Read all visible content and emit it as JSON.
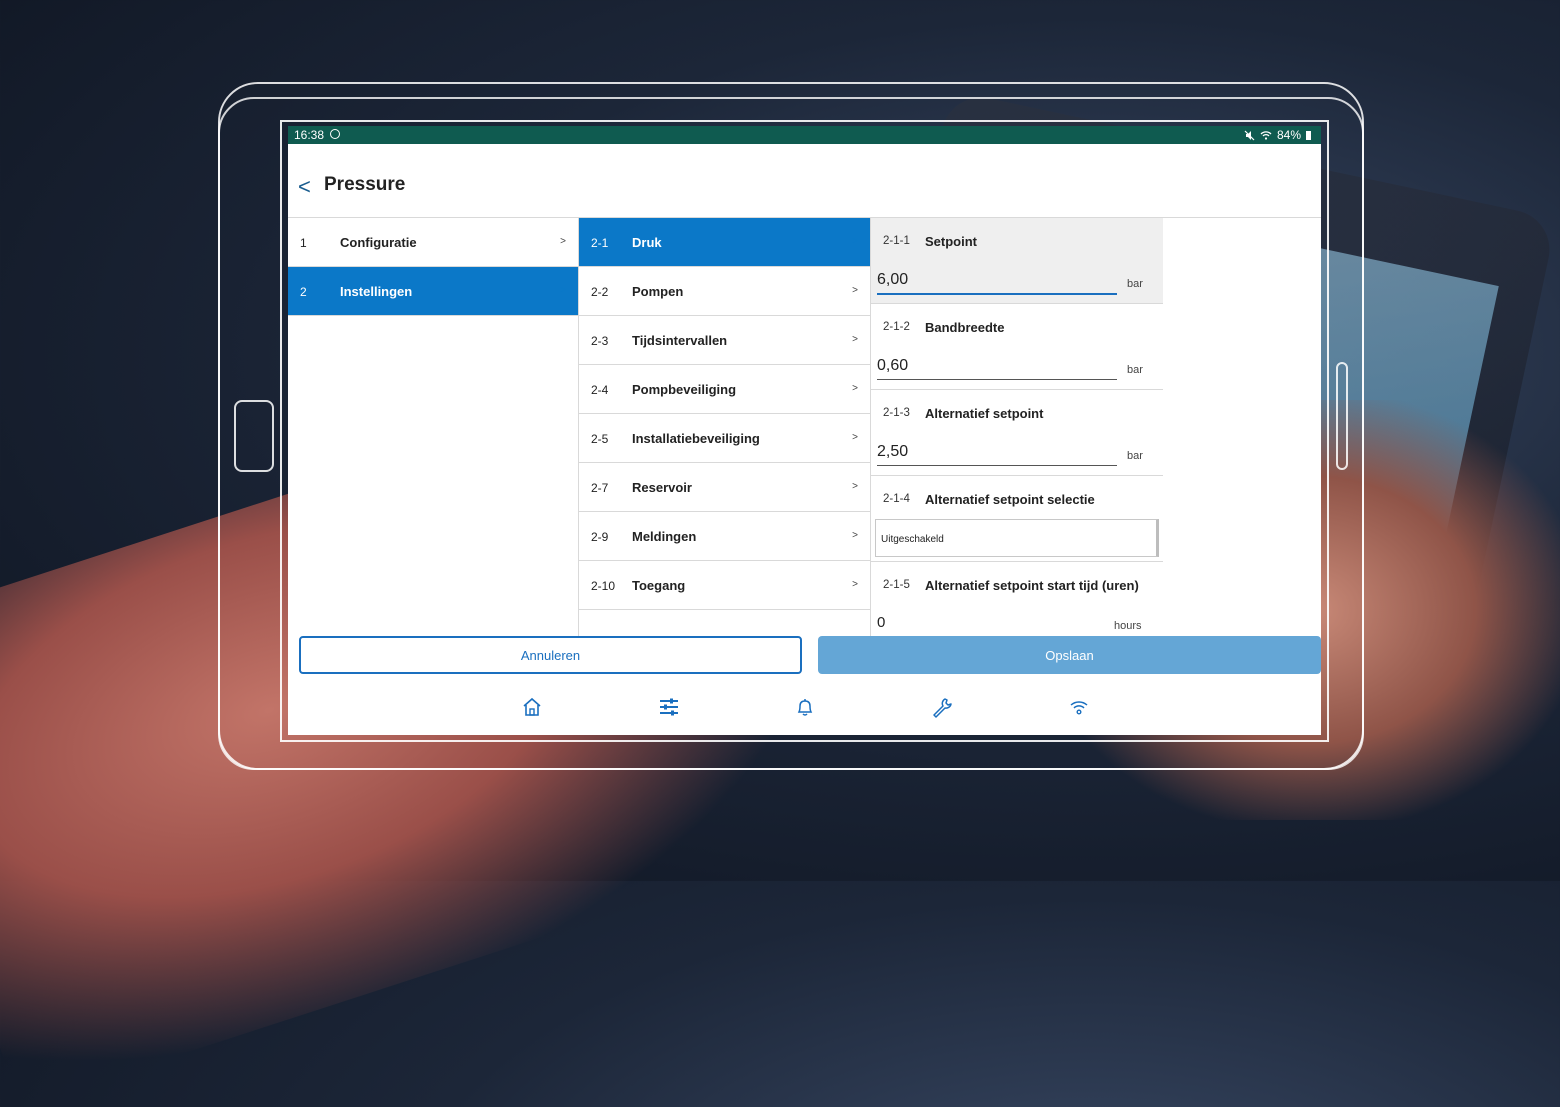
{
  "statusbar": {
    "time": "16:38",
    "battery": "84%"
  },
  "header": {
    "title": "Pressure"
  },
  "col1": [
    {
      "code": "1",
      "label": "Configuratie",
      "active": false
    },
    {
      "code": "2",
      "label": "Instellingen",
      "active": true
    }
  ],
  "col2": [
    {
      "code": "2-1",
      "label": "Druk",
      "active": true
    },
    {
      "code": "2-2",
      "label": "Pompen",
      "active": false
    },
    {
      "code": "2-3",
      "label": "Tijdsintervallen",
      "active": false
    },
    {
      "code": "2-4",
      "label": "Pompbeveiliging",
      "active": false
    },
    {
      "code": "2-5",
      "label": "Installatiebeveiliging",
      "active": false
    },
    {
      "code": "2-7",
      "label": "Reservoir",
      "active": false
    },
    {
      "code": "2-9",
      "label": "Meldingen",
      "active": false
    },
    {
      "code": "2-10",
      "label": "Toegang",
      "active": false
    }
  ],
  "params": [
    {
      "code": "2-1-1",
      "label": "Setpoint",
      "value": "6,00",
      "unit": "bar"
    },
    {
      "code": "2-1-2",
      "label": "Bandbreedte",
      "value": "0,60",
      "unit": "bar"
    },
    {
      "code": "2-1-3",
      "label": "Alternatief setpoint",
      "value": "2,50",
      "unit": "bar"
    },
    {
      "code": "2-1-4",
      "label": "Alternatief setpoint selectie",
      "value": "Uitgeschakeld"
    },
    {
      "code": "2-1-5",
      "label": "Alternatief setpoint start tijd (uren)",
      "value": "0",
      "unit": "hours"
    }
  ],
  "buttons": {
    "cancel": "Annuleren",
    "save": "Opslaan"
  },
  "chevron": ">",
  "back_glyph": "<",
  "nav": [
    "home-icon",
    "sliders-icon",
    "bell-icon",
    "wrench-icon",
    "wifi-icon"
  ],
  "colors": {
    "accent": "#0b78c8",
    "statusbar": "#0f5b50",
    "save": "#64a6d6"
  }
}
